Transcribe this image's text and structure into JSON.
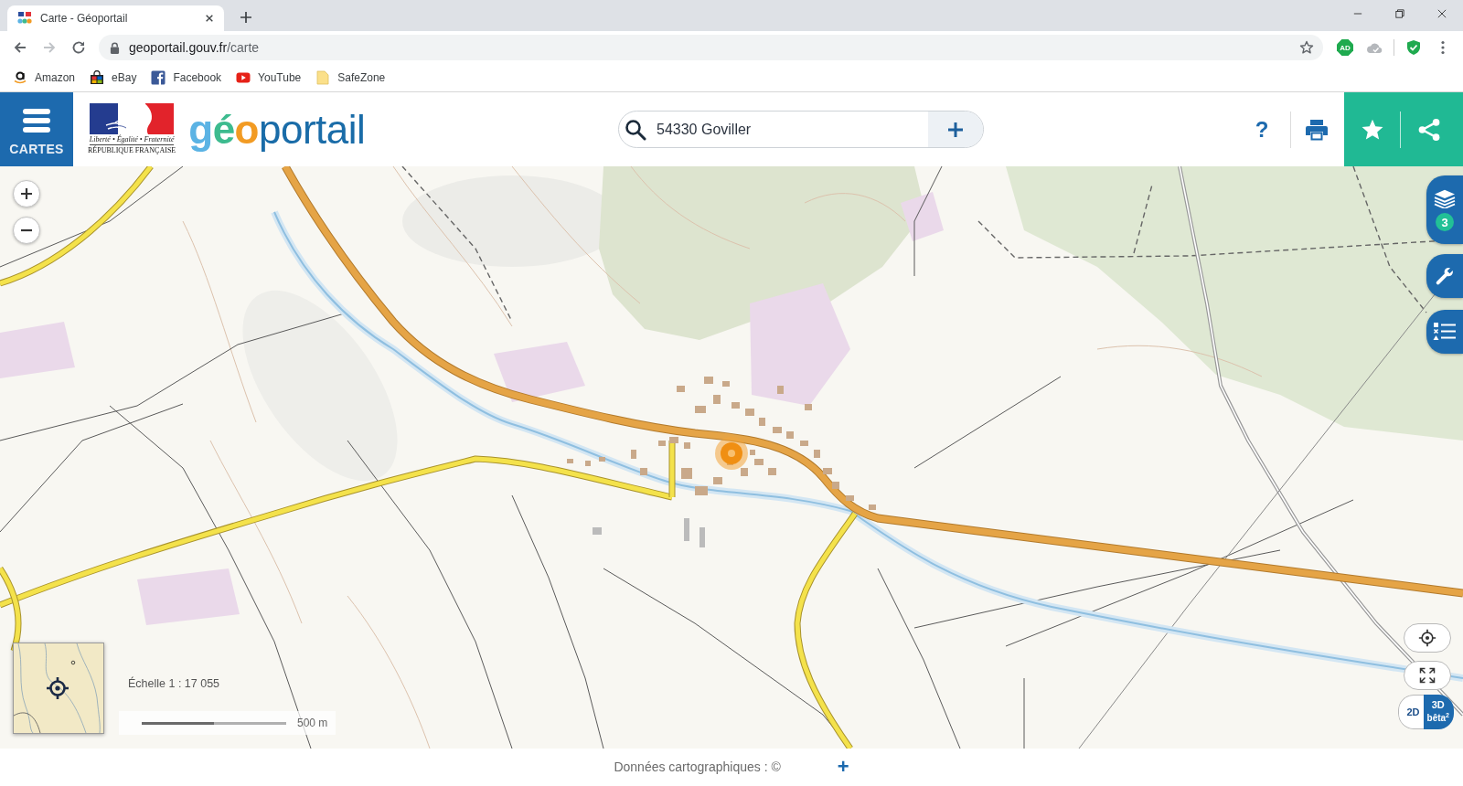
{
  "browser": {
    "tabs": [
      {
        "title": "Carte - Géoportail",
        "selected": true
      }
    ],
    "navigation": {
      "back_disabled": false,
      "forward_disabled": true
    },
    "address": {
      "host": "geoportail.gouv.fr",
      "path": "/carte"
    },
    "extensions": [
      {
        "kind": "badge",
        "label": "AD"
      },
      {
        "kind": "cloud"
      },
      {
        "kind": "shield"
      }
    ],
    "bookmarks": [
      {
        "label": "Amazon",
        "kind": "smile"
      },
      {
        "label": "eBay",
        "kind": "bag"
      },
      {
        "label": "Facebook",
        "kind": "square"
      },
      {
        "label": "YouTube",
        "kind": "play"
      },
      {
        "label": "SafeZone",
        "kind": "page"
      }
    ]
  },
  "header": {
    "menu": {
      "label": "CARTES"
    },
    "emblem": {
      "motto": "Liberté • Égalité • Fraternité",
      "name": "RÉPUBLIQUE FRANÇAISE"
    },
    "brand": [
      "g",
      "é",
      "o",
      "portail"
    ],
    "search": {
      "value": "54330 Goviller"
    },
    "help": {
      "label": "?"
    }
  },
  "map": {
    "side_tabs": [
      {
        "kind": "layers",
        "badge": "3"
      },
      {
        "kind": "tools"
      },
      {
        "kind": "legend"
      }
    ],
    "scale": {
      "ratio": "Échelle 1 : 17 055",
      "bar_label": "500 m"
    },
    "view_modes": [
      {
        "label": "2D",
        "selected": true
      },
      {
        "label": "3D",
        "note": "bêta$^{2}$",
        "selected": false
      }
    ]
  },
  "footer": {
    "attribution": "Données cartographiques : ©",
    "expand": "+"
  }
}
